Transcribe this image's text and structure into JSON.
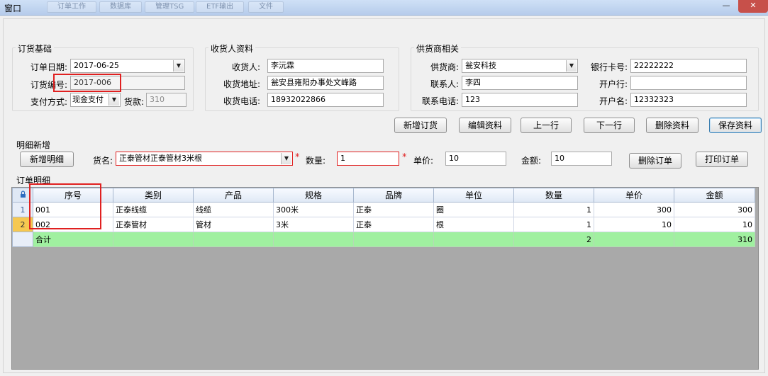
{
  "window": {
    "title": "窗口",
    "bg_tabs": [
      "订单工作",
      "数据库",
      "管理TSG",
      "ETF输出",
      "文件"
    ]
  },
  "order_basic": {
    "title": "订货基础",
    "order_date_label": "订单日期:",
    "order_date": "2017-06-25",
    "order_no_label": "订货编号:",
    "order_no": "2017-006",
    "pay_method_label": "支付方式:",
    "pay_method": "现金支付",
    "amount_label": "货款:",
    "amount": "310"
  },
  "receiver": {
    "title": "收货人资料",
    "name_label": "收货人:",
    "name": "李沅霖",
    "address_label": "收货地址:",
    "address": "瓮安县雍阳办事处文峰路",
    "phone_label": "收货电话:",
    "phone": "18932022866"
  },
  "supplier": {
    "title": "供货商相关",
    "supplier_label": "供货商:",
    "supplier": "瓮安科技",
    "contact_label": "联系人:",
    "contact": "李四",
    "phone_label": "联系电话:",
    "phone": "123",
    "bank_card_label": "银行卡号:",
    "bank_card": "22222222",
    "bank_label": "开户行:",
    "bank": "",
    "account_name_label": "开户名:",
    "account_name": "12332323"
  },
  "actions": {
    "new_order": "新增订货",
    "edit": "编辑资料",
    "prev": "上一行",
    "next": "下一行",
    "delete": "删除资料",
    "save": "保存资料"
  },
  "detail_new": {
    "title": "明细新增",
    "add_detail": "新增明细",
    "goods_label": "货名:",
    "goods": "正泰管材正泰管材3米根",
    "qty_label": "数量:",
    "qty": "1",
    "price_label": "单价:",
    "price": "10",
    "total_label": "金额:",
    "total": "10",
    "delete_order": "删除订单",
    "print_order": "打印订单"
  },
  "order_detail": {
    "title": "订单明细",
    "columns": [
      "序号",
      "类别",
      "产品",
      "规格",
      "品牌",
      "单位",
      "数量",
      "单价",
      "金额"
    ],
    "rows": [
      {
        "rownum": "1",
        "cells": [
          "001",
          "正泰线缆",
          "线缆",
          "300米",
          "正泰",
          "圈",
          "1",
          "300",
          "300"
        ]
      },
      {
        "rownum": "2",
        "cells": [
          "002",
          "正泰管材",
          "管材",
          "3米",
          "正泰",
          "根",
          "1",
          "10",
          "10"
        ]
      }
    ],
    "total_row": {
      "label": "合计",
      "qty": "2",
      "amount": "310"
    }
  }
}
